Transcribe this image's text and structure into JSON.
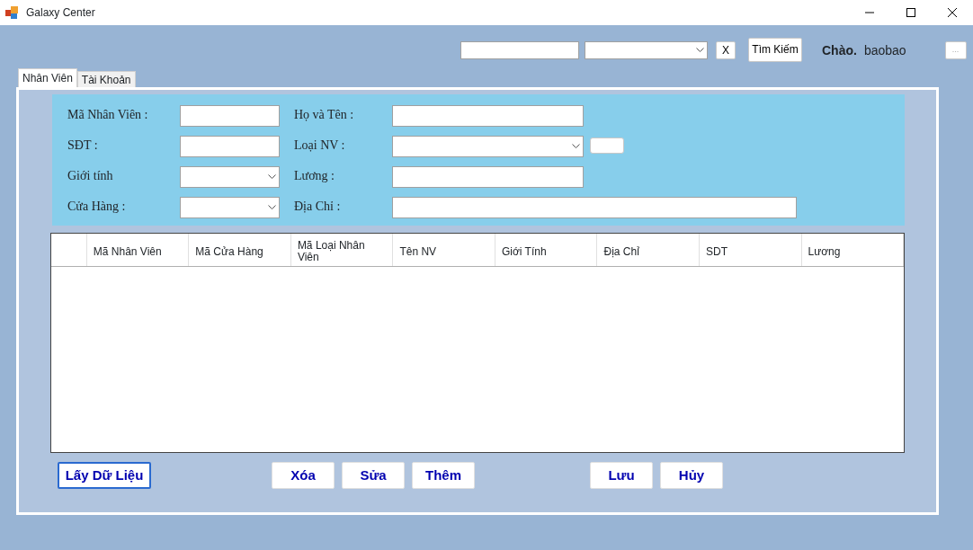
{
  "window": {
    "title": "Galaxy Center"
  },
  "toolbar": {
    "clear_button": "X",
    "search_button": "Tìm Kiếm",
    "greeting": "Chào.",
    "username": "baobao",
    "more_button": "..."
  },
  "tabs": [
    {
      "label": "Nhân Viên",
      "selected": true
    },
    {
      "label": "Tài Khoản",
      "selected": false
    }
  ],
  "form": {
    "rows": [
      [
        {
          "label": "Mã Nhân Viên :",
          "kind": "text"
        },
        {
          "label": "Họ và Tên :",
          "kind": "text"
        }
      ],
      [
        {
          "label": "SĐT :",
          "kind": "text"
        },
        {
          "label": "Loại NV :",
          "kind": "combo-button"
        }
      ],
      [
        {
          "label": "Giới tính",
          "kind": "combo"
        },
        {
          "label": "Lương :",
          "kind": "text"
        }
      ],
      [
        {
          "label": "Cửa Hàng :",
          "kind": "combo"
        },
        {
          "label": "Địa Chỉ :",
          "kind": "wide"
        }
      ]
    ]
  },
  "table": {
    "columns": [
      "Mã Nhân Viên",
      "Mã Cửa Hàng",
      "Mã Loại Nhân Viên",
      "Tên NV",
      "Giới Tính",
      "Địa Chỉ",
      "SDT",
      "Lương"
    ]
  },
  "button_groups": [
    [
      {
        "label": "Lấy Dữ Liệu",
        "focused": true
      }
    ],
    [
      {
        "label": "Xóa",
        "focused": false
      },
      {
        "label": "Sửa",
        "focused": false
      },
      {
        "label": "Thêm",
        "focused": false
      }
    ],
    [
      {
        "label": "Lưu",
        "focused": false
      },
      {
        "label": "Hủy",
        "focused": false
      }
    ]
  ]
}
